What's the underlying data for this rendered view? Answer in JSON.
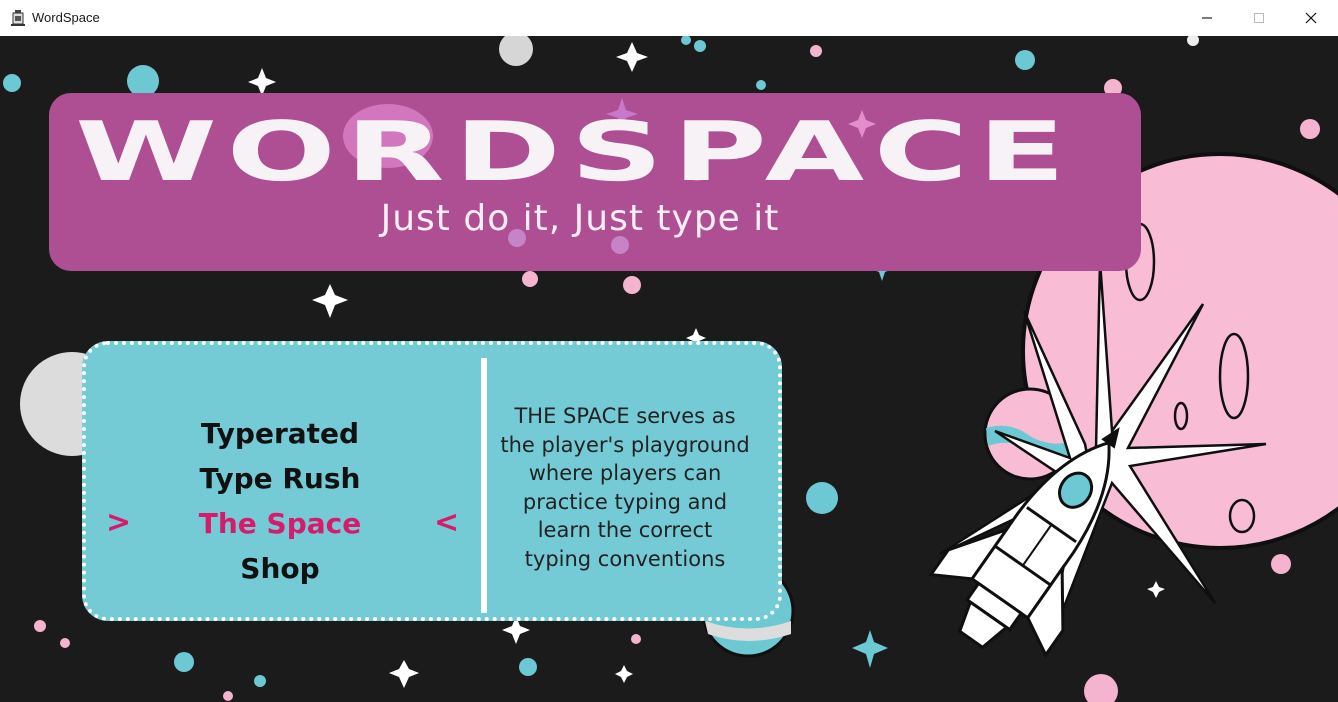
{
  "window": {
    "title": "WordSpace",
    "controls": [
      "minimize-icon",
      "maximize-icon",
      "close-icon"
    ]
  },
  "header": {
    "logo_text": "WORDSPACE",
    "tagline": "Just do it, Just type it"
  },
  "menu": {
    "items": [
      {
        "label": "Typerated",
        "selected": false
      },
      {
        "label": "Type Rush",
        "selected": false
      },
      {
        "label": "The Space",
        "selected": true
      },
      {
        "label": "Shop",
        "selected": false
      }
    ],
    "left_arrow": ">",
    "right_arrow": "<",
    "description_lines": [
      "THE SPACE serves as",
      "the player's playground",
      "where players can",
      "practice typing and",
      "learn the correct",
      "typing conventions"
    ]
  },
  "colors": {
    "background": "#1b1b1b",
    "banner": "#ad4f92",
    "panel": "#74cbd6",
    "accent": "#d81a6b",
    "planet_pink": "#f8bcd5",
    "star_teal": "#6cc8d2"
  }
}
